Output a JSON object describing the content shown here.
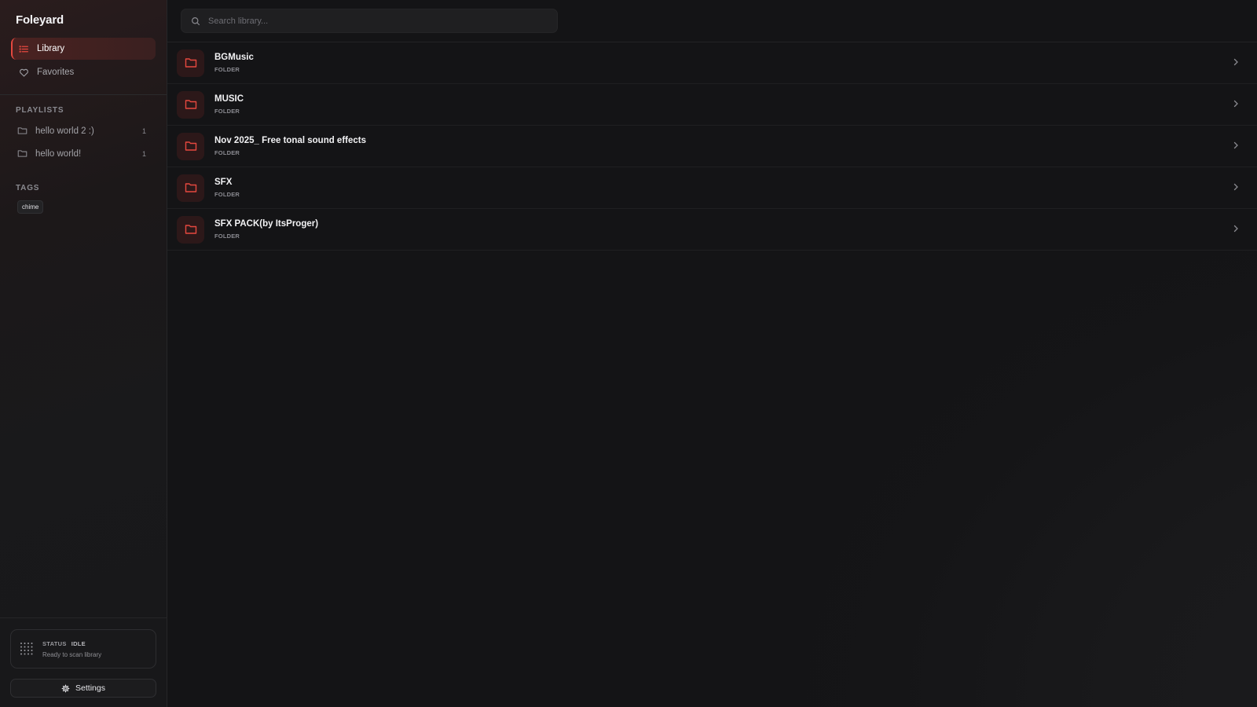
{
  "app": {
    "title": "Foleyard"
  },
  "sidebar": {
    "nav": [
      {
        "label": "Library",
        "icon": "list-icon",
        "active": true
      },
      {
        "label": "Favorites",
        "icon": "heart-icon",
        "active": false
      }
    ],
    "playlists_title": "PLAYLISTS",
    "playlists": [
      {
        "name": "hello world 2 :)",
        "count": "1"
      },
      {
        "name": "hello world!",
        "count": "1"
      }
    ],
    "tags_title": "TAGS",
    "tags": [
      "chime"
    ],
    "status": {
      "label": "STATUS",
      "value": "IDLE",
      "message": "Ready to scan library"
    },
    "settings_label": "Settings"
  },
  "search": {
    "placeholder": "Search library..."
  },
  "items": [
    {
      "name": "BGMusic",
      "type": "FOLDER"
    },
    {
      "name": "MUSIC",
      "type": "FOLDER"
    },
    {
      "name": "Nov 2025_ Free tonal sound effects",
      "type": "FOLDER"
    },
    {
      "name": "SFX",
      "type": "FOLDER"
    },
    {
      "name": "SFX PACK(by ItsProger)",
      "type": "FOLDER"
    }
  ],
  "colors": {
    "accent": "#e5483f",
    "background": "#141416",
    "sidebar": "#1a1a1c"
  }
}
